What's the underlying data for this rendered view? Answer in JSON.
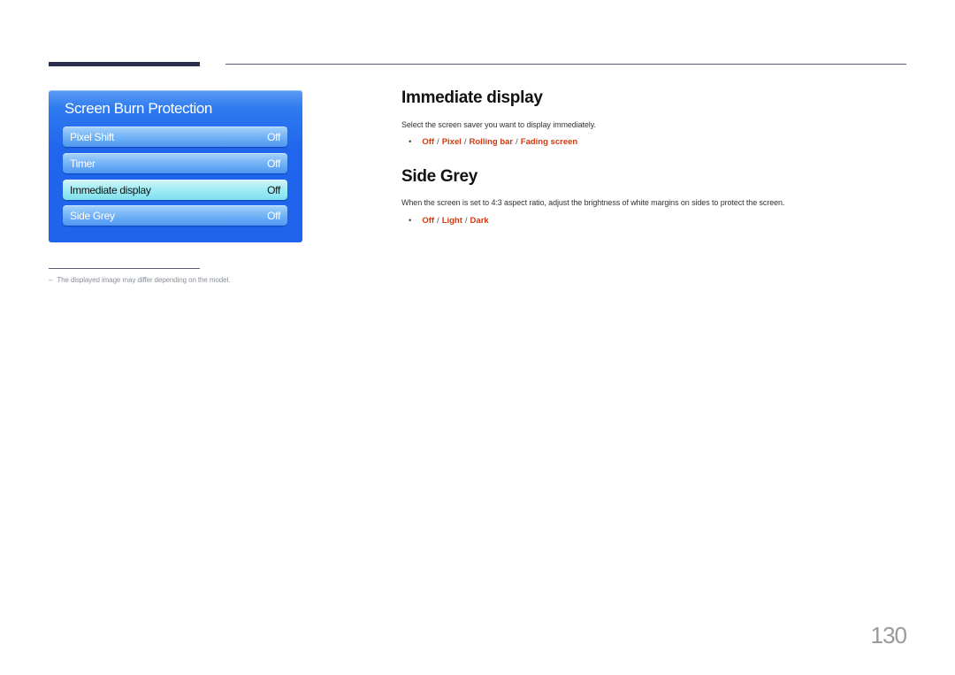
{
  "osd_menu": {
    "title": "Screen Burn Protection",
    "items": [
      {
        "label": "Pixel Shift",
        "value": "Off",
        "selected": false
      },
      {
        "label": "Timer",
        "value": "Off",
        "selected": false
      },
      {
        "label": "Immediate display",
        "value": "Off",
        "selected": true
      },
      {
        "label": "Side Grey",
        "value": "Off",
        "selected": false
      }
    ]
  },
  "footnote": {
    "dash": "–",
    "text": "The displayed image may differ depending on the model."
  },
  "sections": [
    {
      "heading": "Immediate display",
      "description": "Select the screen saver you want to display immediately.",
      "bullet": "•",
      "options": [
        "Off",
        "Pixel",
        "Rolling bar",
        "Fading screen"
      ],
      "separator": "/"
    },
    {
      "heading": "Side Grey",
      "description": "When the screen is set to 4:3 aspect ratio, adjust the brightness of white margins on sides to protect the screen.",
      "bullet": "•",
      "options": [
        "Off",
        "Light",
        "Dark"
      ],
      "separator": "/"
    }
  ],
  "page_number": "130",
  "colors": {
    "option_highlight": "#d03a10",
    "osd_blue": "#1f66ec",
    "header_bar": "#2a2f4f"
  }
}
